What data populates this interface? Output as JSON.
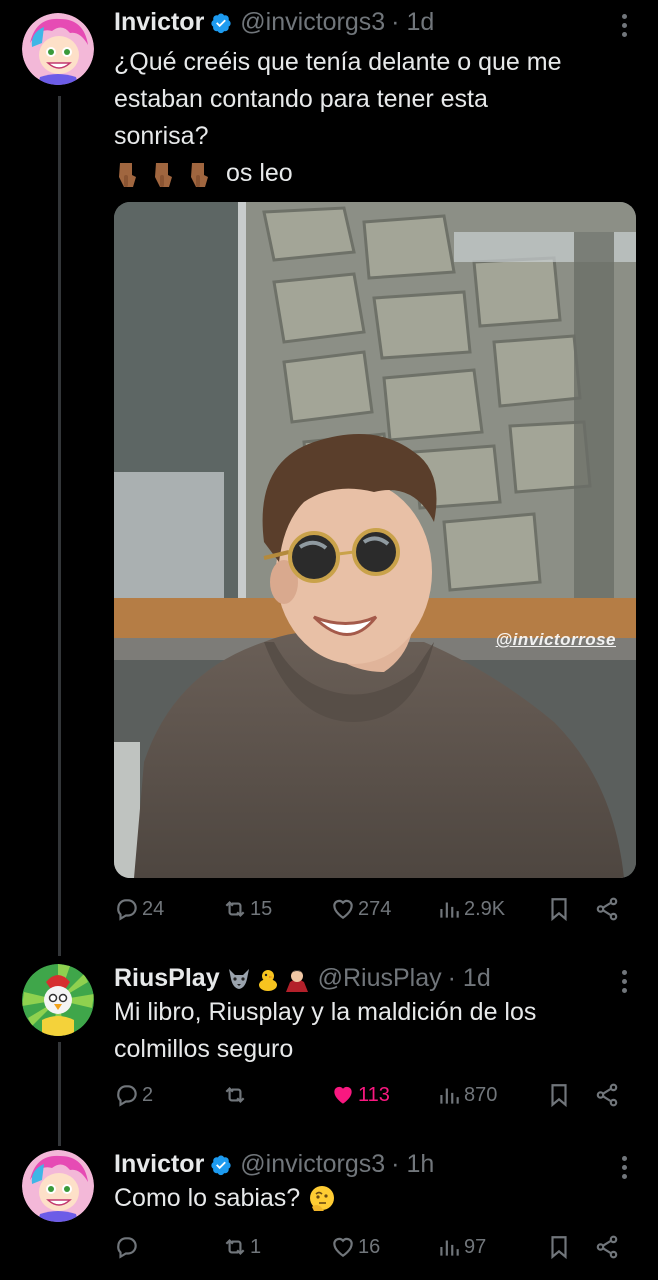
{
  "tweets": [
    {
      "name": "Invictor",
      "verified": true,
      "handle": "@invictorgs3",
      "time": "· 1d",
      "lines": [
        "¿Qué creéis que tenía delante o que me",
        "estaban contando para tener esta",
        "sonrisa?"
      ],
      "emoji_line": "os leo",
      "emoji_icons": [
        "pointing-down-hand-icon",
        "pointing-down-hand-icon",
        "pointing-down-hand-icon"
      ],
      "image_watermark": "@invictorrose",
      "stats": {
        "replies": "24",
        "retweets": "15",
        "likes": "274",
        "views": "2.9K"
      }
    },
    {
      "name": "RiusPlay",
      "name_emojis": [
        "wolf-icon",
        "chick-icon",
        "vampire-icon"
      ],
      "handle": "@RiusPlay",
      "time": "· 1d",
      "lines": [
        "Mi libro, Riusplay y la maldición de los",
        "colmillos seguro"
      ],
      "stats": {
        "replies": "2",
        "retweets": "",
        "likes": "113",
        "views": "870"
      },
      "liked": true
    },
    {
      "name": "Invictor",
      "verified": true,
      "handle": "@invictorgs3",
      "time": "· 1h",
      "lines": [
        "Como lo sabias?"
      ],
      "trailing_emoji": "thinking-face-icon",
      "stats": {
        "replies": "",
        "retweets": "1",
        "likes": "16",
        "views": "97"
      }
    }
  ],
  "colors": {
    "background": "#000000",
    "text": "#e7e9ea",
    "muted": "#71767b",
    "verified": "#1d9bf0",
    "like": "#f91880"
  }
}
